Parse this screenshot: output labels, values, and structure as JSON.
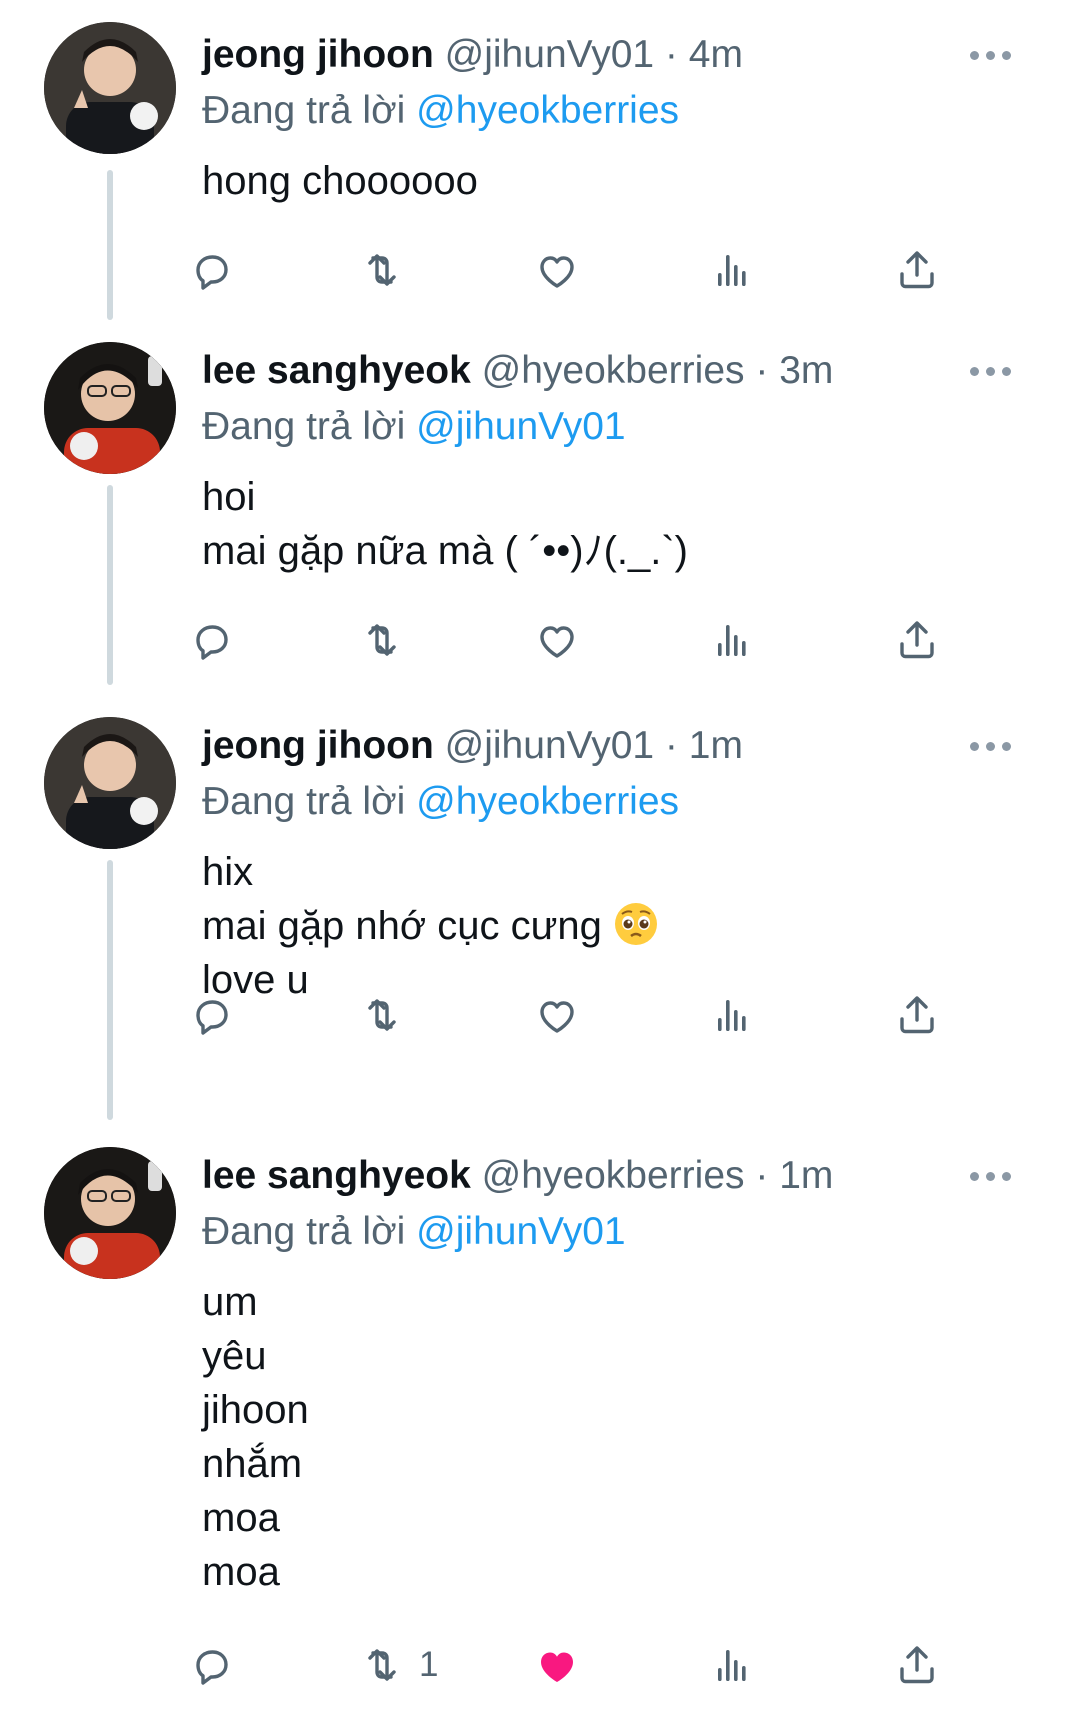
{
  "colors": {
    "text": "#0f1419",
    "muted": "#536471",
    "link": "#1d9bf0",
    "like_active": "#f91880",
    "thread_line": "#cfd9de"
  },
  "replying_label": "Đang trả lời",
  "tweets": [
    {
      "name": "jeong jihoon",
      "handle": "@jihunVy01",
      "time": "4m",
      "reply_to": "@hyeokberries",
      "lines": [
        "hong choooooo"
      ],
      "retweets": "",
      "liked": false
    },
    {
      "name": "lee sanghyeok",
      "handle": "@hyeokberries",
      "time": "3m",
      "reply_to": "@jihunVy01",
      "lines": [
        "hoi",
        "mai gặp nữa mà ( ´••)ﾉ(._.`)"
      ],
      "retweets": "",
      "liked": false
    },
    {
      "name": "jeong jihoon",
      "handle": "@jihunVy01",
      "time": "1m",
      "reply_to": "@hyeokberries",
      "lines": [
        "hix",
        "mai gặp nhớ cục cưng",
        "love u"
      ],
      "retweets": "",
      "liked": false
    },
    {
      "name": "lee sanghyeok",
      "handle": "@hyeokberries",
      "time": "1m",
      "reply_to": "@jihunVy01",
      "lines": [
        "um",
        "yêu",
        "jihoon",
        "nhắm",
        "moa",
        "moa"
      ],
      "retweets": "1",
      "liked": true
    }
  ]
}
